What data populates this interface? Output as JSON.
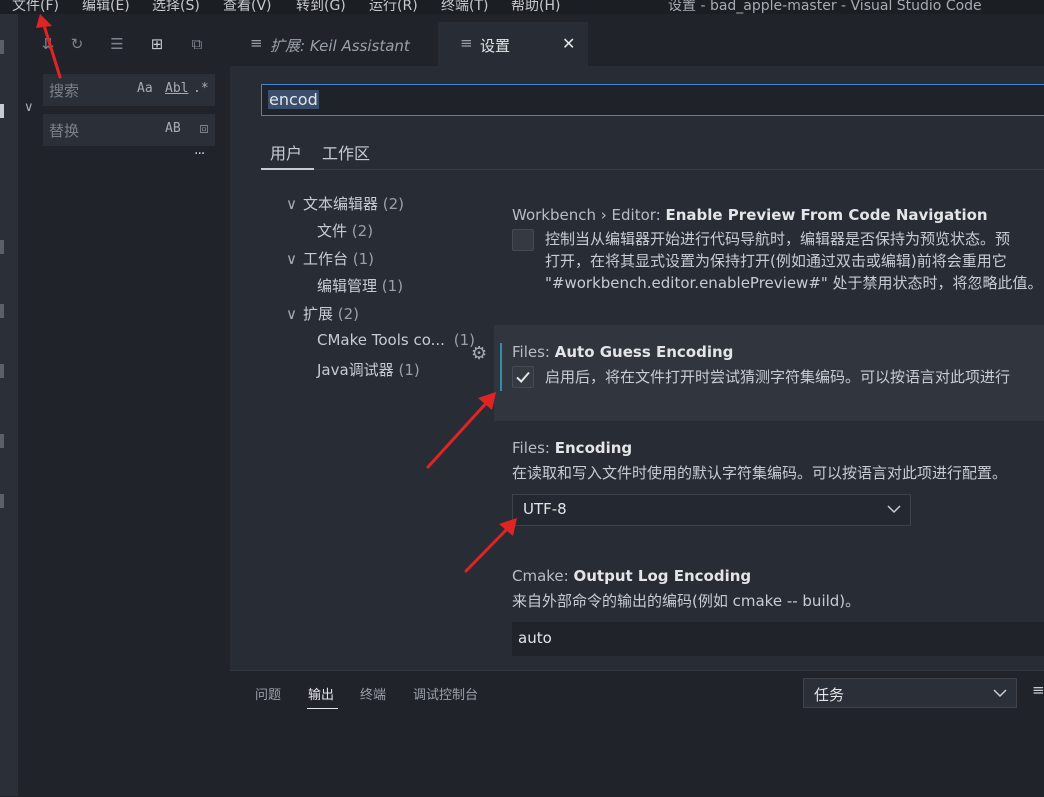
{
  "menu": {
    "items": [
      "文件(F)",
      "编辑(E)",
      "选择(S)",
      "查看(V)",
      "转到(G)",
      "运行(R)",
      "终端(T)",
      "帮助(H)"
    ],
    "window_title": "设置 - bad_apple-master - Visual Studio Code"
  },
  "sidebar": {
    "search_placeholder": "搜索",
    "search_options": [
      "Aa",
      "Abl",
      ".*"
    ],
    "replace_placeholder": "替换",
    "replace_option": "AB",
    "more": "···"
  },
  "tabs": [
    {
      "label": "扩展: Keil Assistant",
      "active": false
    },
    {
      "label": "设置",
      "active": true
    }
  ],
  "settings": {
    "search_value": "encod",
    "scopes": [
      "用户",
      "工作区"
    ],
    "toc": [
      {
        "label": "文本编辑器",
        "count": "(2)",
        "expanded": true
      },
      {
        "label": "文件",
        "count": "(2)"
      },
      {
        "label": "工作台",
        "count": "(1)",
        "expanded": true
      },
      {
        "label": "编辑管理",
        "count": "(1)"
      },
      {
        "label": "扩展",
        "count": "(2)",
        "expanded": true
      },
      {
        "label": "CMake Tools co...",
        "count": "(1)"
      },
      {
        "label": "Java调试器",
        "count": "(1)"
      }
    ],
    "items": [
      {
        "category": "Workbench › Editor: ",
        "name": "Enable Preview From Code Navigation",
        "desc": [
          "控制当从编辑器开始进行代码导航时，编辑器是否保持为预览状态。预",
          "打开，在将其显式设置为保持打开(例如通过双击或编辑)前将会重用它",
          "\"#workbench.editor.enablePreview#\" 处于禁用状态时，将忽略此值。"
        ],
        "checked": false
      },
      {
        "category": "Files: ",
        "name": "Auto Guess Encoding",
        "desc": [
          "启用后，将在文件打开时尝试猜测字符集编码。可以按语言对此项进行"
        ],
        "checked": true
      },
      {
        "category": "Files: ",
        "name": "Encoding",
        "desc": [
          "在读取和写入文件时使用的默认字符集编码。可以按语言对此项进行配置。"
        ],
        "value": "UTF-8"
      },
      {
        "category": "Cmake: ",
        "name": "Output Log Encoding",
        "desc": [
          "来自外部命令的输出的编码(例如 cmake -- build)。"
        ],
        "value": "auto"
      }
    ]
  },
  "panel": {
    "tabs": [
      "问题",
      "输出",
      "终端",
      "调试控制台"
    ],
    "active_tab": "输出",
    "task_select": "任务"
  },
  "colors": {
    "accent": "#3f87d6",
    "annotation": "#e02424"
  }
}
